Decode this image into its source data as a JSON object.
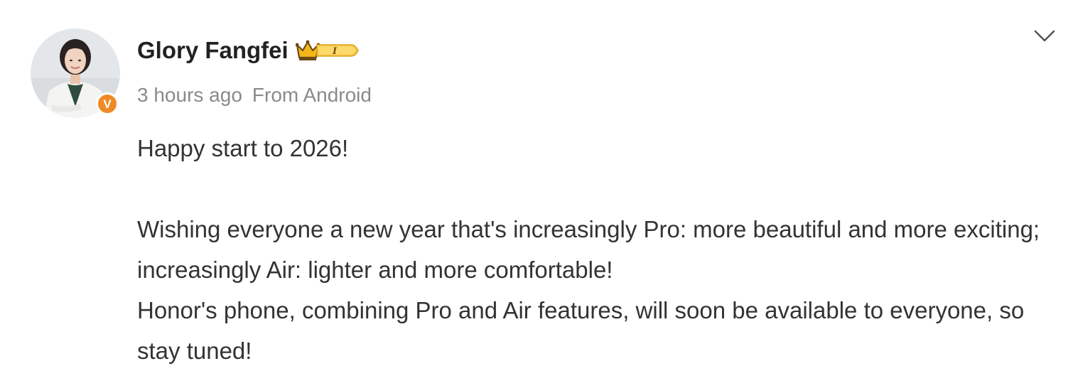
{
  "post": {
    "author": {
      "name": "Glory Fangfei",
      "avatar_icon": "avatar-photo",
      "verified_badge_label": "V",
      "rank_badge_label": "I"
    },
    "meta": {
      "time": "3 hours ago",
      "source": "From Android"
    },
    "content": {
      "line1": "Happy start to 2026!",
      "paragraph2": "Wishing everyone a new year that's increasingly Pro: more beautiful and more exciting; increasingly Air: lighter and more comfortable!",
      "paragraph3": "Honor's phone, combining Pro and Air features, will soon be available to everyone, so stay tuned!"
    },
    "menu_icon": "chevron-down-icon"
  },
  "colors": {
    "verified_orange": "#f08a24",
    "badge_gold": "#f3b71d",
    "text_main": "#333333",
    "text_meta": "#8a8a8a"
  }
}
